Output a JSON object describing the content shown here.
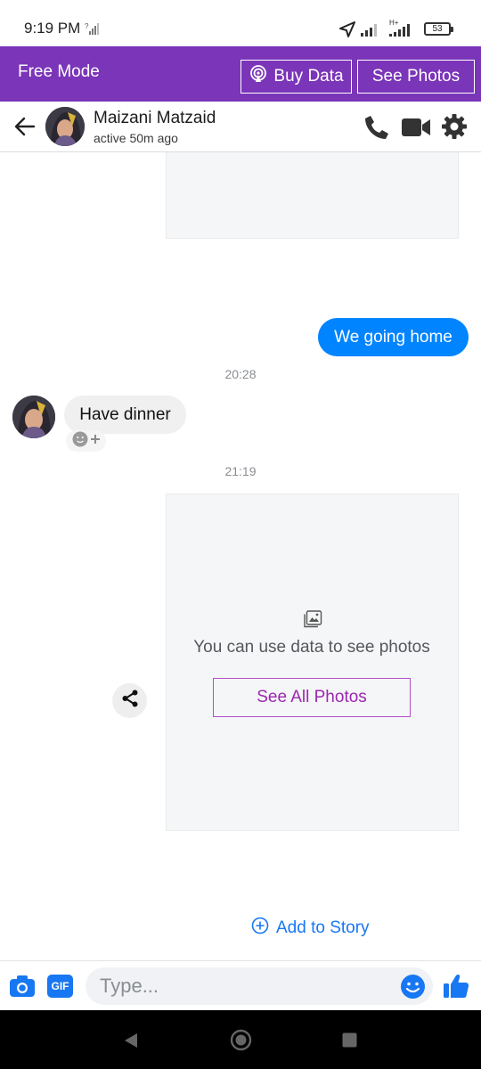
{
  "status_bar": {
    "time": "9:19 PM",
    "battery": "53",
    "network_label": "H+"
  },
  "free_bar": {
    "mode_label": "Free Mode",
    "buy_data_label": "Buy Data",
    "see_photos_label": "See Photos",
    "background_color": "#7b35b8"
  },
  "header": {
    "contact_name": "Maizani Matzaid",
    "contact_status": "active 50m ago"
  },
  "messages": {
    "outgoing_1": "We going home",
    "timestamp_1": "20:28",
    "incoming_1": "Have dinner",
    "timestamp_2": "21:19",
    "data_note": "You can use data to see photos",
    "see_all_photos_label": "See All Photos",
    "add_to_story_label": "Add to Story"
  },
  "composer": {
    "placeholder": "Type...",
    "gif_label": "GIF"
  },
  "colors": {
    "messenger_blue": "#0084ff",
    "accent_blue": "#1877f2",
    "purple": "#7b35b8"
  },
  "icons": [
    "back-arrow-icon",
    "phone-icon",
    "video-icon",
    "gear-icon",
    "share-icon",
    "camera-icon",
    "gif-icon",
    "emoji-icon",
    "thumbs-up-icon",
    "image-icon",
    "plus-circle-icon"
  ]
}
